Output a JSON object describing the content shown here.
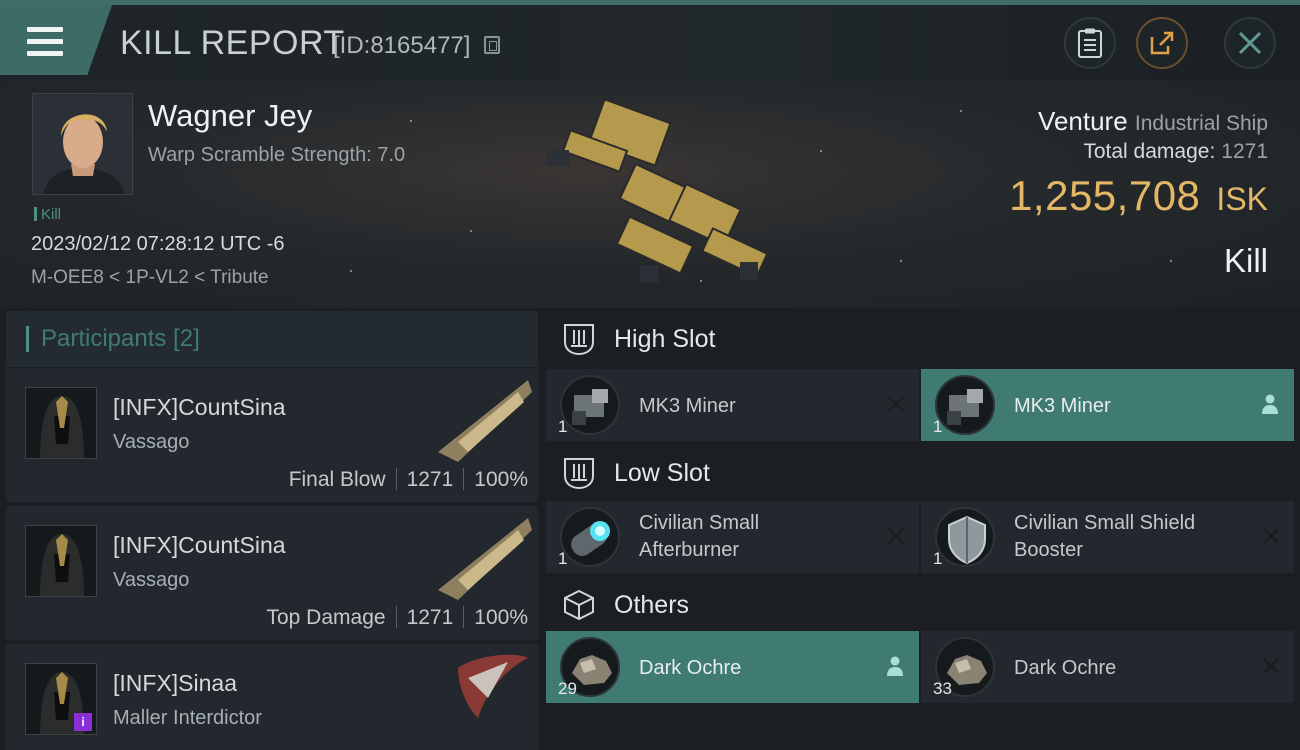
{
  "header": {
    "title": "KILL REPORT",
    "report_id": "[ID:8165477]",
    "accent_color": "#3d6c67"
  },
  "victim": {
    "name": "Wagner Jey",
    "warp_scramble": "Warp Scramble Strength: 7.0",
    "tag": "Kill",
    "datetime": "2023/02/12 07:28:12 UTC -6",
    "location": "M-OEE8 < 1P-VL2 < Tribute",
    "ship_name": "Venture",
    "ship_class": "Industrial Ship",
    "total_damage_label": "Total damage:",
    "total_damage": "1271",
    "isk_value": "1,255,708",
    "isk_currency": "ISK",
    "result": "Kill"
  },
  "participants": {
    "title": "Participants [2]",
    "rows": [
      {
        "name": "[INFX]CountSina",
        "ship": "Vassago",
        "role": "Final Blow",
        "damage": "1271",
        "percent": "100%"
      },
      {
        "name": "[INFX]CountSina",
        "ship": "Vassago",
        "role": "Top Damage",
        "damage": "1271",
        "percent": "100%"
      },
      {
        "name": "[INFX]Sinaa",
        "ship": "Maller Interdictor",
        "badge": "i"
      }
    ]
  },
  "fitting": {
    "high_slot": {
      "title": "High Slot",
      "modules": [
        {
          "name": "MK3 Miner",
          "qty": "1",
          "state": "destroyed"
        },
        {
          "name": "MK3 Miner",
          "qty": "1",
          "state": "dropped"
        }
      ]
    },
    "low_slot": {
      "title": "Low Slot",
      "modules": [
        {
          "name_line1": "Civilian Small",
          "name_line2": "Afterburner",
          "qty": "1",
          "state": "destroyed"
        },
        {
          "name_line1": "Civilian Small Shield",
          "name_line2": "Booster",
          "qty": "1",
          "state": "destroyed"
        }
      ]
    },
    "others": {
      "title": "Others",
      "modules": [
        {
          "name": "Dark Ochre",
          "qty": "29",
          "state": "dropped"
        },
        {
          "name": "Dark Ochre",
          "qty": "33",
          "state": "destroyed"
        }
      ]
    }
  },
  "colors": {
    "isk_gold": "#e3b766",
    "teal_highlight": "#3f7b73",
    "panel": "#22282d"
  }
}
